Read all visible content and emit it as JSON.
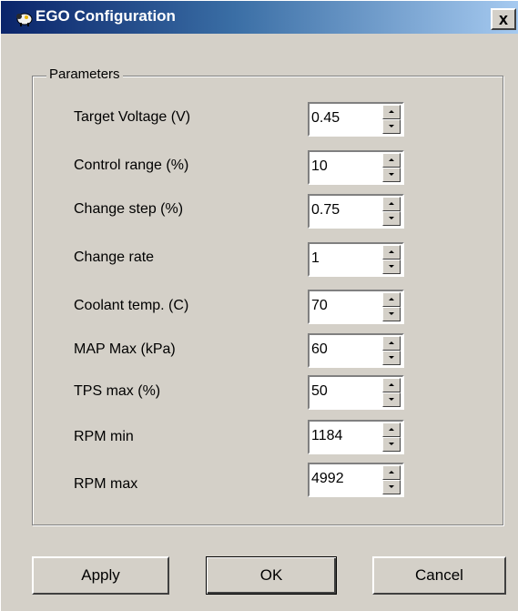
{
  "window": {
    "title": "EGO Configuration",
    "close_glyph": "x"
  },
  "icons": {
    "app": "sheep-app-icon",
    "close": "close-icon"
  },
  "groupbox": {
    "label": "Parameters"
  },
  "parameters": [
    {
      "label": "Target Voltage (V)",
      "value": "0.45"
    },
    {
      "label": "Control range (%)",
      "value": "10"
    },
    {
      "label": "Change step (%)",
      "value": "0.75"
    },
    {
      "label": "Change rate",
      "value": "1"
    },
    {
      "label": "Coolant temp. (C)",
      "value": "70"
    },
    {
      "label": "MAP Max (kPa)",
      "value": "60"
    },
    {
      "label": "TPS max (%)",
      "value": "50"
    },
    {
      "label": "RPM min",
      "value": "1184"
    },
    {
      "label": "RPM max",
      "value": "4992"
    }
  ],
  "buttons": {
    "apply": "Apply",
    "ok": "OK",
    "cancel": "Cancel"
  },
  "colors": {
    "title_start": "#0a246a",
    "title_end": "#a6caf0",
    "face": "#d4d0c8"
  }
}
